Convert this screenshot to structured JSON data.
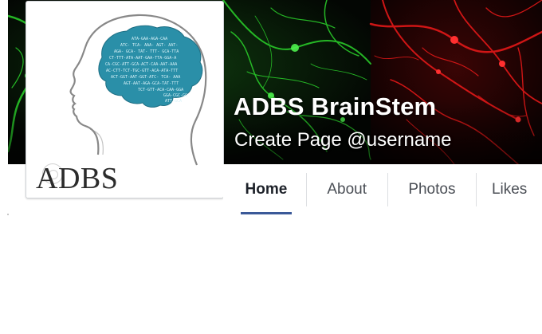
{
  "page": {
    "name": "ADBS BrainStem",
    "handle": "Create Page @username"
  },
  "profile": {
    "logo_text": "ADBS",
    "brain_sequence_lines": [
      "ATA-GAA-AGA-CAA",
      "ATC- TCA- AAA- AGT- AAT-",
      "AGA- GCA- TAT- TTT- GCA-TTA",
      "CT-TTT-ATA-AAT-GAA-TTA-GGA-A",
      "CA-CGC-ATT-GCA-ACT-CAA-AAT-AAA",
      "AC-CTT-TCT-TGC-GTT-ACA-ATA-TTT",
      "ACT-GGT-AAT-GGT-ATC- TCA- AAA",
      "AGT-AAT-AGA-GCA-TAT-TTT",
      "TCT-GTT-ACA-CAA-GGA",
      "GGA-CGC-GG",
      "ATT-GCA"
    ]
  },
  "tabs": [
    {
      "label": "Home",
      "active": true
    },
    {
      "label": "About",
      "active": false
    },
    {
      "label": "Photos",
      "active": false
    },
    {
      "label": "Likes",
      "active": false
    }
  ],
  "colors": {
    "brain_fill": "#2a8fa8",
    "tab_underline": "#3b5998",
    "cover_green": "#2bd42b",
    "cover_red": "#e21818"
  }
}
